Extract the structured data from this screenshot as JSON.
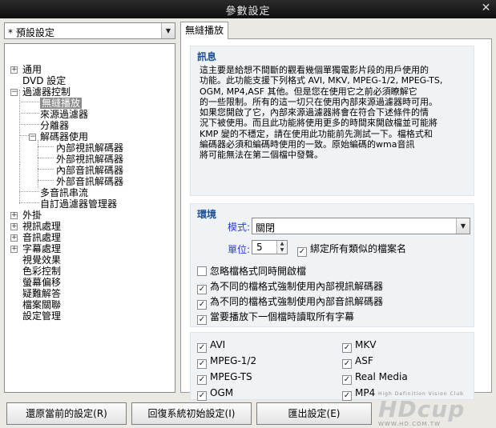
{
  "window": {
    "title": "參數設定",
    "close_icon": "close-icon"
  },
  "preset": {
    "value": "* 預設設定"
  },
  "tree": {
    "items": [
      {
        "label": "通用"
      },
      {
        "label": "DVD 設定"
      },
      {
        "label": "過濾器控制"
      },
      {
        "label": "無縫播放"
      },
      {
        "label": "來源過濾器"
      },
      {
        "label": "分離器"
      },
      {
        "label": "解碼器使用"
      },
      {
        "label": "內部視訊解碼器"
      },
      {
        "label": "外部視訊解碼器"
      },
      {
        "label": "內部音訊解碼器"
      },
      {
        "label": "外部音訊解碼器"
      },
      {
        "label": "多音訊串流"
      },
      {
        "label": "自訂過濾器管理器"
      },
      {
        "label": "外掛"
      },
      {
        "label": "視訊處理"
      },
      {
        "label": "音訊處理"
      },
      {
        "label": "字幕處理"
      },
      {
        "label": "視覺效果"
      },
      {
        "label": "色彩控制"
      },
      {
        "label": "螢幕偏移"
      },
      {
        "label": "疑難解答"
      },
      {
        "label": "檔案關聯"
      },
      {
        "label": "設定管理"
      }
    ]
  },
  "tab": {
    "label": "無縫播放"
  },
  "info": {
    "heading": "訊息",
    "lines": [
      "這主要是給想不間斷的觀看幾個單獨電影片段的用戶使用的",
      "功能。此功能支援下列格式 AVI, MKV, MPEG-1/2, MPEG-TS,",
      "OGM, MP4,ASF 其他。但是您在使用它之前必須瞭解它",
      "的一些限制。所有的這一切只在使用內部來源過濾器時可用。",
      "如果您開啟了它，內部來源過濾器將會在符合下述條件的情",
      "況下被使用。而且此功能將使用更多的時間來開啟檔並可能將",
      "KMP 變的不穩定，請在使用此功能前先測試一下。檔格式和",
      "編碼器必須和編碼時使用的一致。原始編碼的wma音訊",
      "將可能無法在第二個檔中發聲。"
    ]
  },
  "env": {
    "heading": "環境",
    "mode_label": "模式:",
    "mode_value": "關閉",
    "unit_label": "單位:",
    "unit_value": "5",
    "bind_label": "綁定所有類似的檔案名",
    "options": [
      {
        "label": "忽略檔格式同時開啟檔",
        "checked": false
      },
      {
        "label": "為不同的檔格式強制使用內部視訊解碼器",
        "checked": true
      },
      {
        "label": "為不同的檔格式強制使用內部音訊解碼器",
        "checked": true
      },
      {
        "label": "當要播放下一個檔時讀取所有字幕",
        "checked": true
      }
    ]
  },
  "formats": [
    {
      "label": "AVI",
      "checked": true
    },
    {
      "label": "MKV",
      "checked": true
    },
    {
      "label": "MPEG-1/2",
      "checked": true
    },
    {
      "label": "ASF",
      "checked": true
    },
    {
      "label": "MPEG-TS",
      "checked": true
    },
    {
      "label": "Real Media",
      "checked": true
    },
    {
      "label": "OGM",
      "checked": true
    },
    {
      "label": "MP4",
      "checked": true
    }
  ],
  "buttons": {
    "restore": "還原當前的設定(R)",
    "reset": "回復系統初始設定(I)",
    "export": "匯出設定(E)"
  },
  "watermark": {
    "tagline": "High Definition Vision Club",
    "logo": "HDcup",
    "url": "WWW.HD.COM.TW"
  }
}
